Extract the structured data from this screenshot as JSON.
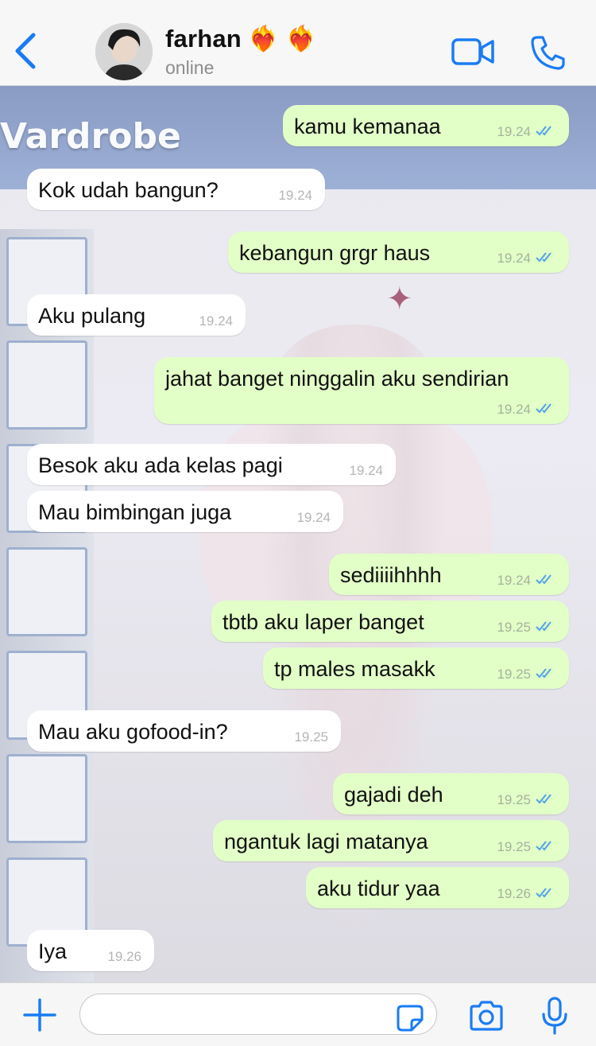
{
  "header": {
    "contact_name": "farhan",
    "hearts": "❤️‍🔥 ❤️‍🔥",
    "status": "online"
  },
  "background": {
    "title_fragment": "Vardrobe"
  },
  "messages": [
    {
      "text": "kamu kemanaa",
      "time": "19.24",
      "direction": "out"
    },
    {
      "text": "Kok udah bangun?",
      "time": "19.24",
      "direction": "in"
    },
    {
      "text": "kebangun grgr haus",
      "time": "19.24",
      "direction": "out"
    },
    {
      "text": "Aku pulang",
      "time": "19.24",
      "direction": "in"
    },
    {
      "text": "jahat banget ninggalin aku sendirian",
      "time": "19.24",
      "direction": "out"
    },
    {
      "text": "Besok aku ada kelas pagi",
      "time": "19.24",
      "direction": "in"
    },
    {
      "text": "Mau bimbingan juga",
      "time": "19.24",
      "direction": "in"
    },
    {
      "text": "sediiiihhhh",
      "time": "19.24",
      "direction": "out"
    },
    {
      "text": "tbtb aku laper banget",
      "time": "19.25",
      "direction": "out"
    },
    {
      "text": "tp males masakk",
      "time": "19.25",
      "direction": "out"
    },
    {
      "text": "Mau aku gofood-in?",
      "time": "19.25",
      "direction": "in"
    },
    {
      "text": "gajadi deh",
      "time": "19.25",
      "direction": "out"
    },
    {
      "text": "ngantuk lagi matanya",
      "time": "19.25",
      "direction": "out"
    },
    {
      "text": "aku tidur yaa",
      "time": "19.26",
      "direction": "out"
    },
    {
      "text": "Iya",
      "time": "19.26",
      "direction": "in"
    }
  ],
  "colors": {
    "accent": "#1a7cf5",
    "outgoing_bubble": "#e2ffc7",
    "incoming_bubble": "#ffffff",
    "read_tick": "#4fa3e8"
  },
  "icons": [
    "back-chevron-icon",
    "video-call-icon",
    "phone-call-icon",
    "plus-icon",
    "sticker-icon",
    "camera-icon",
    "microphone-icon",
    "double-tick-icon"
  ]
}
